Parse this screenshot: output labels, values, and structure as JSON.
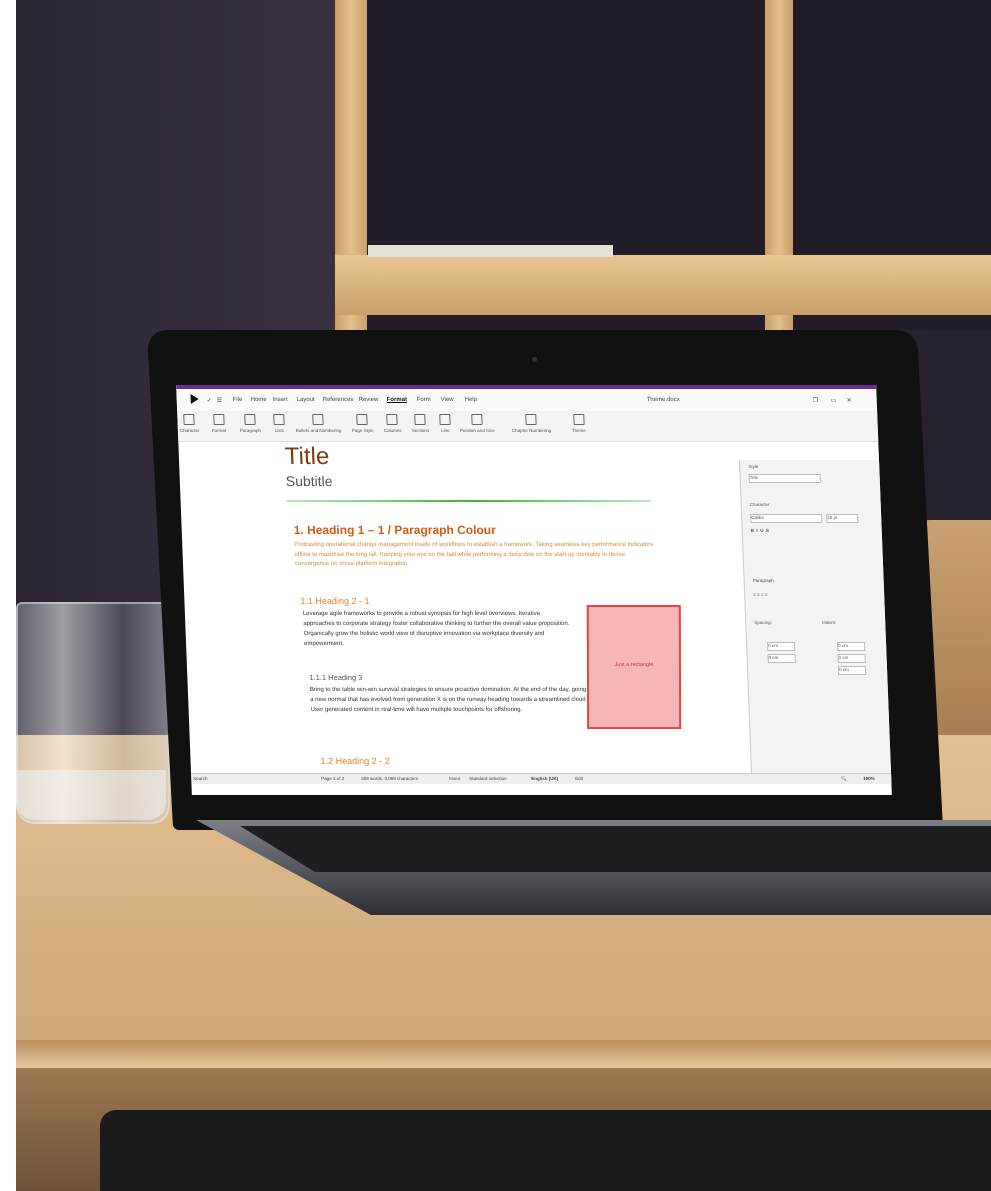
{
  "app": {
    "window_title": "Theme.docx",
    "menu": [
      "File",
      "Home",
      "Insert",
      "Layout",
      "References",
      "Review",
      "Format",
      "Form",
      "View",
      "Help"
    ],
    "active_menu": "Format",
    "toolbar": [
      "Character",
      "Format",
      "Paragraph",
      "Lists",
      "Bullets and Numbering",
      "Page Style",
      "Columns",
      "Sections",
      "Line",
      "Position and Size",
      "Chapter Numbering",
      "Theme"
    ]
  },
  "document": {
    "title": "Title",
    "subtitle": "Subtitle",
    "heading1": "1. Heading 1 – 1 / Paragraph Colour",
    "heading1_body": "Podcasting operational change management inside of workflows to establish a framework. Taking seamless key performance indicators offline to maximise the long tail. Keeping your eye on the ball while performing a deep dive on the start-up mentality to derive convergence on cross-platform integration.",
    "heading2_1": "1.1   Heading 2 - 1",
    "heading2_1_body": "Leverage agile frameworks to provide a robust synopsis for high level overviews. Iterative approaches to corporate strategy foster collaborative thinking to further the overall value proposition. Organically grow the holistic world view of disruptive innovation via workplace diversity and empowerment.",
    "heading3": "1.1.1   Heading 3",
    "heading3_body": "Bring to the table win-win survival strategies to ensure proactive domination. At the end of the day, going forward, a new normal that has evolved from generation X is on the runway heading towards a streamlined cloud solution. User generated content in real-time will have multiple touchpoints for offshoring.",
    "heading2_2": "1.2   Heading 2 - 2",
    "shape_label": "Just a rectangle"
  },
  "sidebar": {
    "style_label": "Style",
    "style_value": "Title",
    "character_label": "Character",
    "font_value": "Calibri",
    "size_value": "28 pt",
    "paragraph_label": "Paragraph",
    "spacing_label": "Spacing:",
    "indent_label": "Indent:",
    "spacing_values": [
      "0 cm",
      "0 cm"
    ],
    "indent_values": [
      "0 cm",
      "0 cm",
      "0 cm"
    ]
  },
  "status": {
    "search_placeholder": "Search",
    "page": "Page 1 of 2",
    "words": "359 words, 3,069 characters",
    "mode": "Insert",
    "selection": "Standard selection",
    "language": "English (UK)",
    "edit": "Edit",
    "zoom": "100%"
  }
}
